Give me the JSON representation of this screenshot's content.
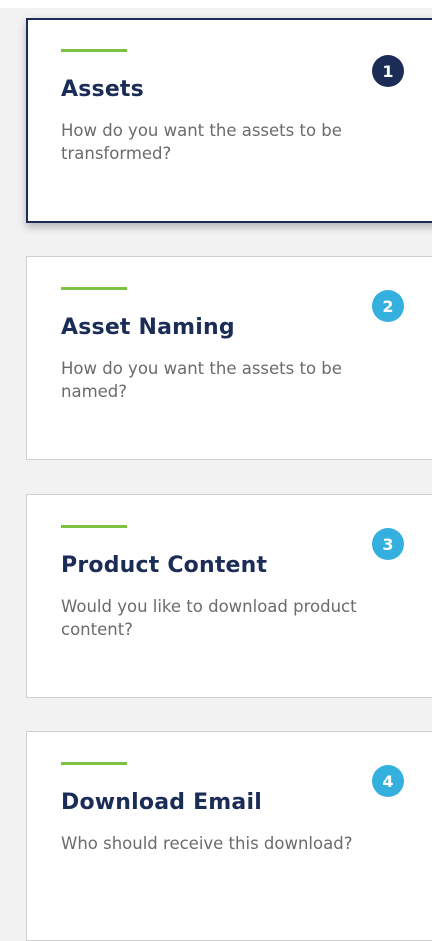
{
  "steps": [
    {
      "number": "1",
      "title": "Assets",
      "description": "How do you want the assets to be transformed?",
      "active": true
    },
    {
      "number": "2",
      "title": "Asset Naming",
      "description": "How do you want the assets to be named?",
      "active": false
    },
    {
      "number": "3",
      "title": "Product Content",
      "description": "Would you like to download product content?",
      "active": false
    },
    {
      "number": "4",
      "title": "Download Email",
      "description": "Who should receive this download?",
      "active": false
    }
  ],
  "colors": {
    "active_badge": "#1b2d57",
    "inactive_badge": "#33b0dd",
    "accent": "#7fc242",
    "title": "#1b2d57",
    "text": "#6b6b6b"
  }
}
